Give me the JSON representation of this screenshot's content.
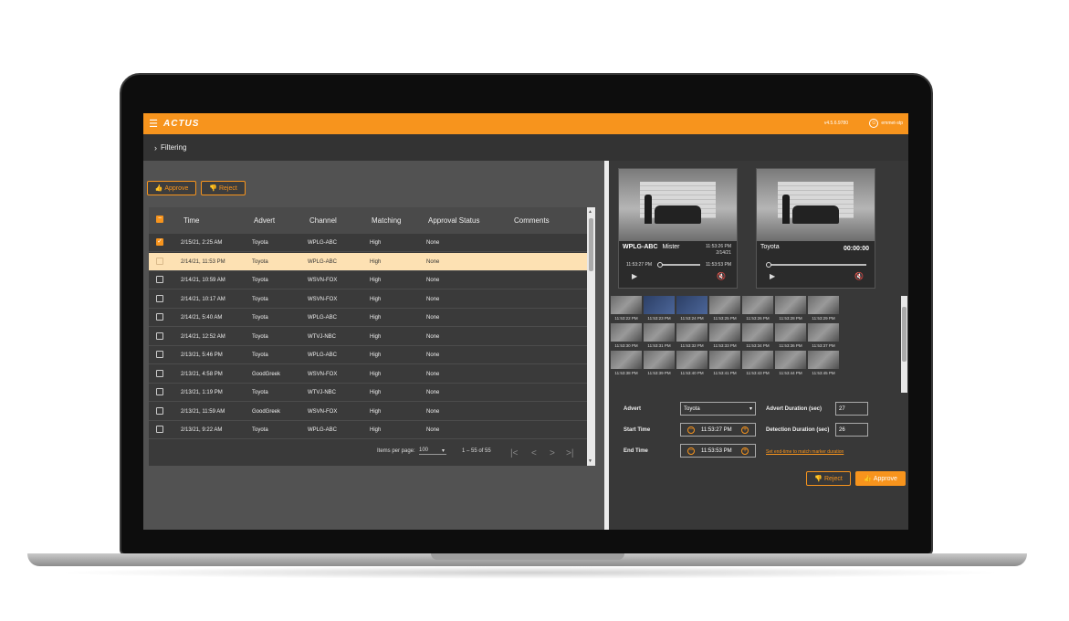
{
  "app": {
    "logo_text": "ACTUS",
    "version": "v4.5.6.9780",
    "user": "emmet-stp",
    "accent_color": "#f7941d"
  },
  "filtering": {
    "label": "Filtering"
  },
  "actions": {
    "approve": "Approve",
    "reject": "Reject"
  },
  "table": {
    "columns": [
      "Time",
      "Advert",
      "Channel",
      "Matching",
      "Approval Status",
      "Comments"
    ],
    "rows": [
      {
        "time": "2/15/21, 2:25 AM",
        "advert": "Toyota",
        "channel": "WPLG-ABC",
        "matching": "High",
        "status": "None",
        "checked": true
      },
      {
        "time": "2/14/21, 11:53 PM",
        "advert": "Toyota",
        "channel": "WPLG-ABC",
        "matching": "High",
        "status": "None",
        "selected": true
      },
      {
        "time": "2/14/21, 10:59 AM",
        "advert": "Toyota",
        "channel": "WSVN-FOX",
        "matching": "High",
        "status": "None"
      },
      {
        "time": "2/14/21, 10:17 AM",
        "advert": "Toyota",
        "channel": "WSVN-FOX",
        "matching": "High",
        "status": "None"
      },
      {
        "time": "2/14/21, 5:40 AM",
        "advert": "Toyota",
        "channel": "WPLG-ABC",
        "matching": "High",
        "status": "None"
      },
      {
        "time": "2/14/21, 12:52 AM",
        "advert": "Toyota",
        "channel": "WTVJ-NBC",
        "matching": "High",
        "status": "None"
      },
      {
        "time": "2/13/21, 5:46 PM",
        "advert": "Toyota",
        "channel": "WPLG-ABC",
        "matching": "High",
        "status": "None"
      },
      {
        "time": "2/13/21, 4:58 PM",
        "advert": "GoodGreek",
        "channel": "WSVN-FOX",
        "matching": "High",
        "status": "None"
      },
      {
        "time": "2/13/21, 1:19 PM",
        "advert": "Toyota",
        "channel": "WTVJ-NBC",
        "matching": "High",
        "status": "None"
      },
      {
        "time": "2/13/21, 11:59 AM",
        "advert": "GoodGreek",
        "channel": "WSVN-FOX",
        "matching": "High",
        "status": "None"
      },
      {
        "time": "2/13/21, 9:22 AM",
        "advert": "Toyota",
        "channel": "WPLG-ABC",
        "matching": "High",
        "status": "None"
      }
    ],
    "pager": {
      "items_per_page_label": "Items per page:",
      "items_per_page": "100",
      "range": "1 – 55 of 55"
    }
  },
  "video_left": {
    "channel": "WPLG-ABC",
    "program": "Mister",
    "time_top": "11:53:26 PM",
    "date_top": "2/14/21",
    "start": "11:53:27 PM",
    "end": "11:53:53 PM",
    "progress": 0.3
  },
  "video_right": {
    "title": "Toyota",
    "timecode": "00:00:00",
    "progress": 0.0
  },
  "thumbnails": [
    "11:53:22 PM",
    "11:53:23 PM",
    "11:53:24 PM",
    "11:53:25 PM",
    "11:53:26 PM",
    "11:53:28 PM",
    "11:53:29 PM",
    "11:53:30 PM",
    "11:53:31 PM",
    "11:53:32 PM",
    "11:53:33 PM",
    "11:53:34 PM",
    "11:53:36 PM",
    "11:53:37 PM",
    "11:53:38 PM",
    "11:53:39 PM",
    "11:53:40 PM",
    "11:53:41 PM",
    "11:53:43 PM",
    "11:53:44 PM",
    "11:53:45 PM"
  ],
  "form": {
    "advert_label": "Advert",
    "advert_value": "Toyota",
    "advert_duration_label": "Advert Duration (sec)",
    "advert_duration": "27",
    "start_label": "Start Time",
    "start_value": "11:53:27 PM",
    "detection_duration_label": "Detection Duration (sec)",
    "detection_duration": "26",
    "end_label": "End Time",
    "end_value": "11:53:53 PM",
    "link_text": "Set end-time to match marker duration"
  },
  "icons": {
    "menu": "☰",
    "chevron": "›",
    "thumb_up": "👍",
    "thumb_down": "👎",
    "play": "▶",
    "mute": "🔇",
    "first": "|<",
    "prev": "<",
    "next": ">",
    "last": ">|",
    "minus": "−",
    "plus": "+",
    "caret": "▾",
    "user": "☺"
  }
}
